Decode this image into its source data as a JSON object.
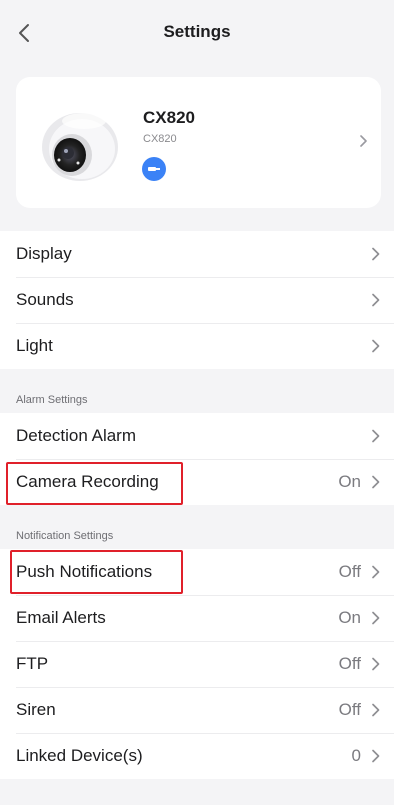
{
  "header": {
    "title": "Settings"
  },
  "device": {
    "name": "CX820",
    "model": "CX820"
  },
  "groups": {
    "general": [
      {
        "label": "Display"
      },
      {
        "label": "Sounds"
      },
      {
        "label": "Light"
      }
    ],
    "alarm": {
      "title": "Alarm Settings",
      "items": [
        {
          "label": "Detection Alarm",
          "value": ""
        },
        {
          "label": "Camera Recording",
          "value": "On"
        }
      ]
    },
    "notification": {
      "title": "Notification Settings",
      "items": [
        {
          "label": "Push Notifications",
          "value": "Off"
        },
        {
          "label": "Email Alerts",
          "value": "On"
        },
        {
          "label": "FTP",
          "value": "Off"
        },
        {
          "label": "Siren",
          "value": "Off"
        },
        {
          "label": "Linked Device(s)",
          "value": "0"
        }
      ]
    }
  },
  "colors": {
    "accent": "#3b82f6",
    "highlight": "#e0202a",
    "background": "#f4f4f6"
  },
  "icons": {
    "back": "chevron-left-icon",
    "row": "chevron-right-icon",
    "badge": "ethernet-icon"
  }
}
